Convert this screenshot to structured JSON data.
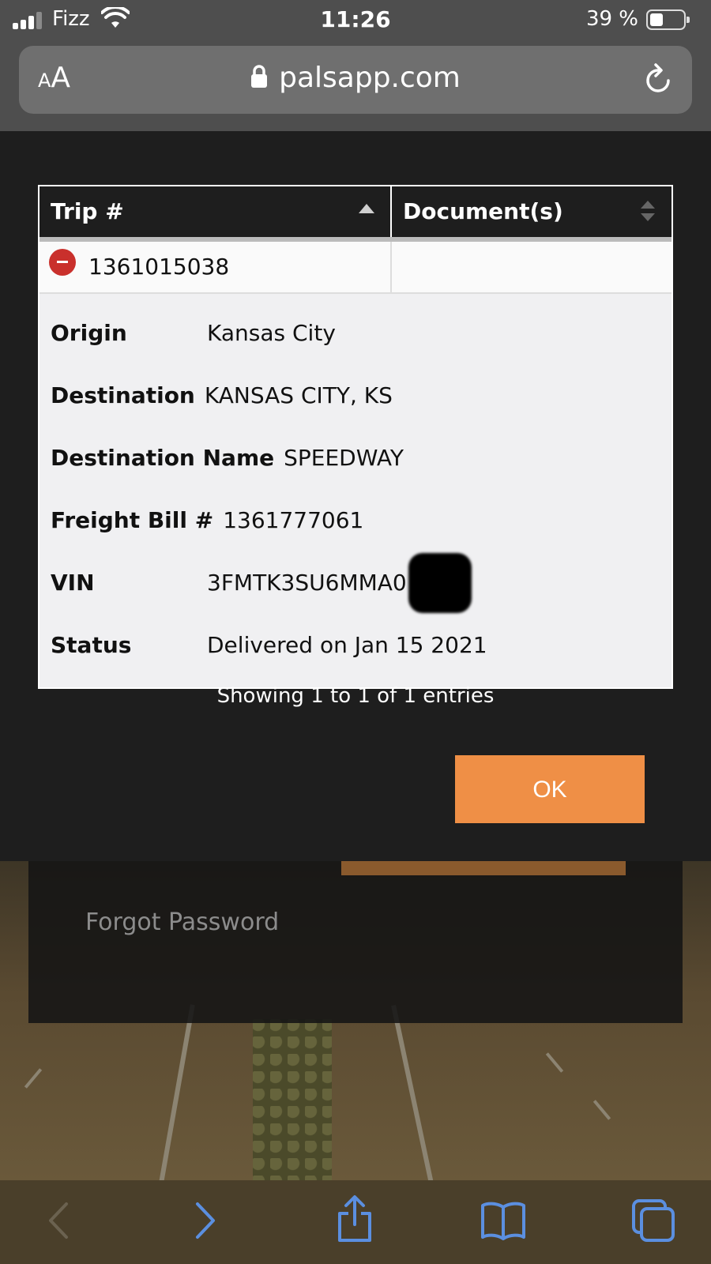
{
  "status_bar": {
    "carrier": "Fizz",
    "time": "11:26",
    "battery_percent": "39 %"
  },
  "browser": {
    "text_size_label": "AA",
    "url": "palsapp.com"
  },
  "modal": {
    "table": {
      "columns": [
        "Trip #",
        "Document(s)"
      ],
      "row": {
        "trip_number": "1361015038",
        "documents": ""
      },
      "details": [
        {
          "label": "Origin",
          "value": "Kansas City"
        },
        {
          "label": "Destination",
          "value": "KANSAS CITY, KS"
        },
        {
          "label": "Destination Name",
          "value": "SPEEDWAY"
        },
        {
          "label": "Freight Bill #",
          "value": "1361777061"
        },
        {
          "label": "VIN",
          "value": "3FMTK3SU6MMA0"
        },
        {
          "label": "Status",
          "value": "Delivered on Jan 15 2021"
        }
      ]
    },
    "info": "Showing 1 to 1 of 1 entries",
    "ok_label": "OK"
  },
  "background_page": {
    "forgot_password": "Forgot Password"
  },
  "colors": {
    "accent": "#ef8f46",
    "remove_icon": "#c9302c",
    "toolbar_icons": "#5b8fe0"
  }
}
